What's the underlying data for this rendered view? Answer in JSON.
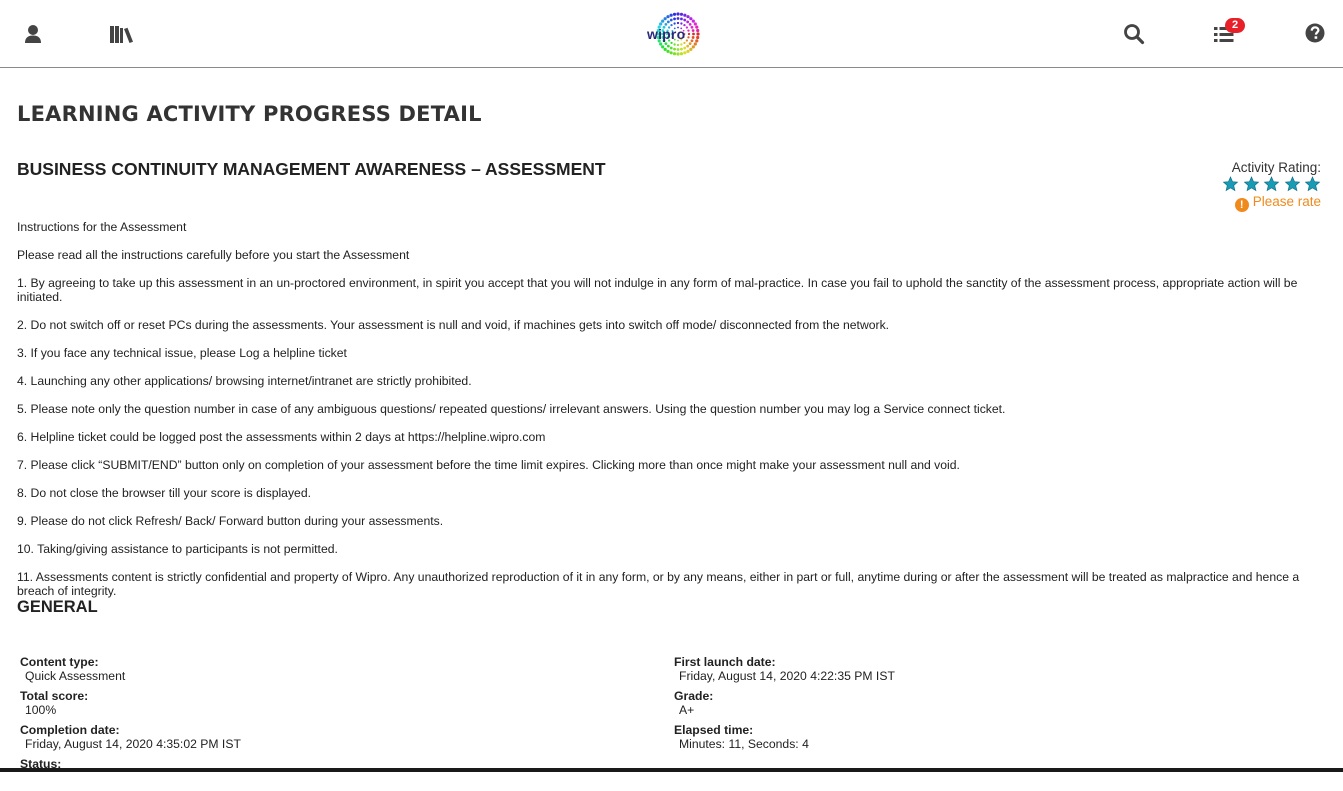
{
  "header": {
    "logo_text": "wipro",
    "notification_count": "2",
    "icons": [
      "user-icon",
      "library-icon",
      "search-icon",
      "task-list-icon",
      "help-icon"
    ]
  },
  "page": {
    "title": "LEARNING ACTIVITY PROGRESS DETAIL",
    "activity_title": "BUSINESS CONTINUITY MANAGEMENT AWARENESS – ASSESSMENT"
  },
  "rating": {
    "label": "Activity Rating:",
    "stars": 5,
    "star_color": "#1a9bb5",
    "prompt": "Please rate",
    "prompt_color": "#f08a1c"
  },
  "instructions": {
    "heading": "Instructions for the Assessment",
    "intro": "Please read all the instructions carefully before you start the Assessment",
    "items": [
      "1. By agreeing to take up this assessment in an un-proctored environment, in spirit you accept that you will not indulge in any form of mal-practice. In case you fail to uphold the sanctity of the assessment process, appropriate action will be initiated.",
      "2. Do not switch off or reset PCs during the assessments. Your assessment is null and void, if machines gets into switch off mode/ disconnected from the network.",
      "3. If you face any technical issue, please Log a helpline ticket",
      "4. Launching any other applications/ browsing internet/intranet are strictly prohibited.",
      "5. Please note only the question number in case of any ambiguous questions/ repeated questions/ irrelevant answers. Using the question number you may log a Service connect ticket.",
      "6. Helpline ticket could be logged post the assessments within 2 days at https://helpline.wipro.com",
      "7. Please click “SUBMIT/END” button only on completion of your assessment before the time limit expires. Clicking more than once might make your assessment null and void.",
      "8. Do not close the browser till your score is displayed.",
      "9. Please do not click Refresh/ Back/ Forward button during your assessments.",
      "10. Taking/giving assistance to participants is not permitted.",
      "11. Assessments content is strictly confidential and property of Wipro. Any unauthorized reproduction of it in any form, or by any means, either in part or full, anytime during or after the assessment will be treated as malpractice and hence a breach of integrity."
    ]
  },
  "general": {
    "heading": "GENERAL",
    "left": [
      {
        "label": "Content type:",
        "value": "Quick Assessment"
      },
      {
        "label": "Total score:",
        "value": "100%"
      },
      {
        "label": "Completion date:",
        "value": "Friday, August 14, 2020 4:35:02 PM IST"
      },
      {
        "label": "Status:",
        "value": ""
      }
    ],
    "right": [
      {
        "label": "First launch date:",
        "value": "Friday, August 14, 2020 4:22:35 PM IST"
      },
      {
        "label": "Grade:",
        "value": "A+"
      },
      {
        "label": "Elapsed time:",
        "value": "Minutes: 11, Seconds: 4"
      }
    ]
  }
}
